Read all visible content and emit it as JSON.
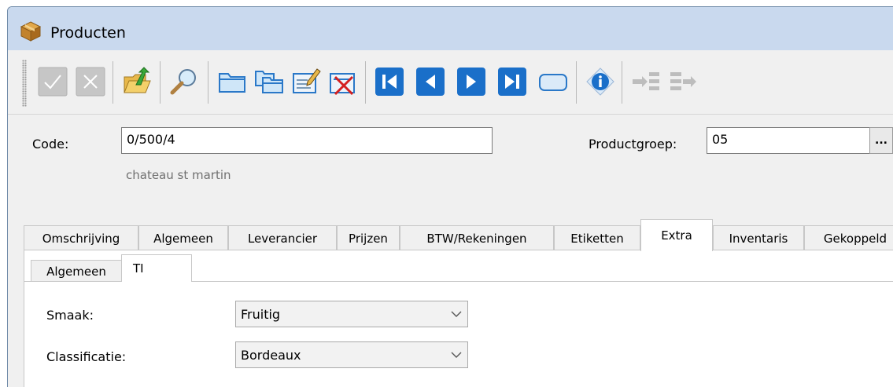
{
  "window": {
    "title": "Producten"
  },
  "toolbar": {
    "buttons": [
      {
        "name": "confirm-button",
        "icon": "check-icon"
      },
      {
        "name": "cancel-button",
        "icon": "close-icon"
      },
      {
        "name": "open-folder-button",
        "icon": "folder-up-icon"
      },
      {
        "name": "search-button",
        "icon": "magnifier-icon"
      },
      {
        "name": "new-record-button",
        "icon": "folder-icon"
      },
      {
        "name": "copy-record-button",
        "icon": "folders-icon"
      },
      {
        "name": "edit-record-button",
        "icon": "edit-icon"
      },
      {
        "name": "delete-record-button",
        "icon": "delete-icon"
      },
      {
        "name": "first-record-button",
        "icon": "skip-first-icon"
      },
      {
        "name": "previous-record-button",
        "icon": "previous-icon"
      },
      {
        "name": "next-record-button",
        "icon": "next-icon"
      },
      {
        "name": "last-record-button",
        "icon": "skip-last-icon"
      },
      {
        "name": "blank-button",
        "icon": "rounded-rect-icon"
      },
      {
        "name": "info-button",
        "icon": "info-icon"
      },
      {
        "name": "merge-button",
        "icon": "merge-icon"
      },
      {
        "name": "export-button",
        "icon": "export-icon"
      }
    ]
  },
  "form": {
    "code_label": "Code:",
    "code_value": "0/500/4",
    "description": "chateau st martin",
    "productgroep_label": "Productgroep:",
    "productgroep_value": "05",
    "ellipsis": "..."
  },
  "tabs": [
    {
      "label": "Omschrijving"
    },
    {
      "label": "Algemeen"
    },
    {
      "label": "Leverancier"
    },
    {
      "label": "Prijzen"
    },
    {
      "label": "BTW/Rekeningen"
    },
    {
      "label": "Etiketten"
    },
    {
      "label": "Extra"
    },
    {
      "label": "Inventaris"
    },
    {
      "label": "Gekoppeld"
    }
  ],
  "subtabs": [
    {
      "label": "Algemeen"
    },
    {
      "label": "TI"
    }
  ],
  "extra": {
    "smaak_label": "Smaak:",
    "smaak_value": "Fruitig",
    "classificatie_label": "Classificatie:",
    "classificatie_value": "Bordeaux"
  },
  "colors": {
    "titlebar": "#c9d9ee",
    "nav_blue": "#1a6fc9"
  }
}
